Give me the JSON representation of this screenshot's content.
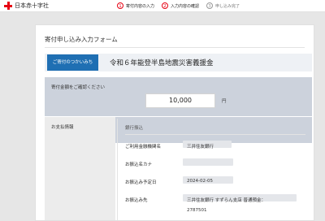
{
  "header": {
    "org_name": "日本赤十字社",
    "steps": [
      {
        "num": "1",
        "label": "寄付内容の入力"
      },
      {
        "num": "2",
        "label": "入力内容の確認"
      },
      {
        "num": "3",
        "label": "申し込み完了"
      }
    ]
  },
  "form": {
    "title": "寄付申し込み入力フォーム",
    "campaign_tag": "ご寄付のつかいみち",
    "campaign_name": "令和６年能登半島地震災害義援金",
    "amount_label": "寄付金額をご確認ください",
    "amount_value": "10,000",
    "amount_unit": "円",
    "payment_label": "お支払情報",
    "bank": {
      "title": "銀行振込",
      "rows": [
        {
          "label": "ご利用金融機関名",
          "value": "三井住友銀行"
        },
        {
          "label": "お振込名カナ",
          "value": ""
        },
        {
          "label": "お振込み予定日",
          "value": "2024-02-05"
        },
        {
          "label": "お振込み先",
          "value": "三井住友銀行 すずらん支店 普通預金："
        },
        {
          "label": "",
          "value": "2787501"
        }
      ]
    }
  }
}
